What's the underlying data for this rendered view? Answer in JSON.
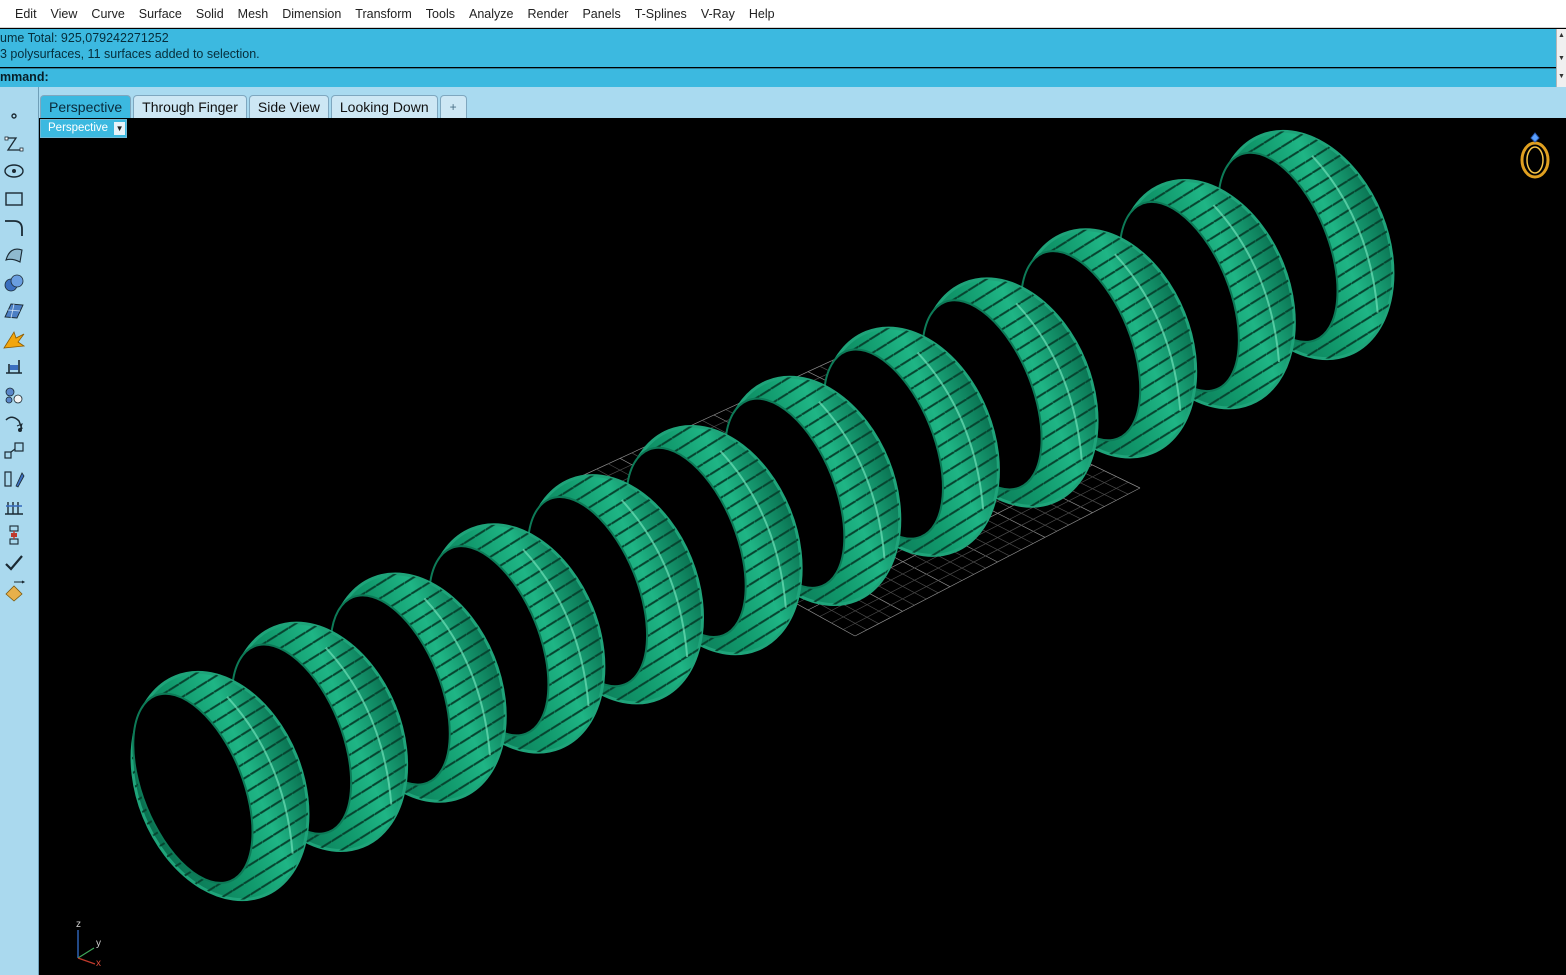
{
  "menu": {
    "items": [
      "Edit",
      "View",
      "Curve",
      "Surface",
      "Solid",
      "Mesh",
      "Dimension",
      "Transform",
      "Tools",
      "Analyze",
      "Render",
      "Panels",
      "T-Splines",
      "V-Ray",
      "Help"
    ]
  },
  "history": {
    "line1": "ume Total: 925,079242271252",
    "line2": "3 polysurfaces, 11 surfaces added to selection."
  },
  "command": {
    "label": "mmand:",
    "value": ""
  },
  "tabs": {
    "items": [
      "Perspective",
      "Through Finger",
      "Side View",
      "Looking Down"
    ],
    "add_label": "+"
  },
  "viewport": {
    "label": "Perspective",
    "dropdown": "▼",
    "axis_labels": {
      "z": "z",
      "y": "y",
      "x": "x"
    }
  },
  "toolbar": {
    "icons": [
      "point-icon",
      "polyline-icon",
      "circle-icon",
      "rectangle-icon",
      "curve-fillet-icon",
      "surface-icon",
      "solid-sphere-icon",
      "mesh-icon",
      "explode-icon",
      "dimension-icon",
      "array-icon",
      "rotate-icon",
      "scale-icon",
      "mirror-icon",
      "distribute-icon",
      "gumball-icon",
      "check-icon",
      "render-icon"
    ]
  },
  "colors": {
    "accent": "#3cb9e0",
    "panel": "#aad9ee",
    "ring_fill": "#0c8a63",
    "ring_edge": "#1fa47a"
  }
}
